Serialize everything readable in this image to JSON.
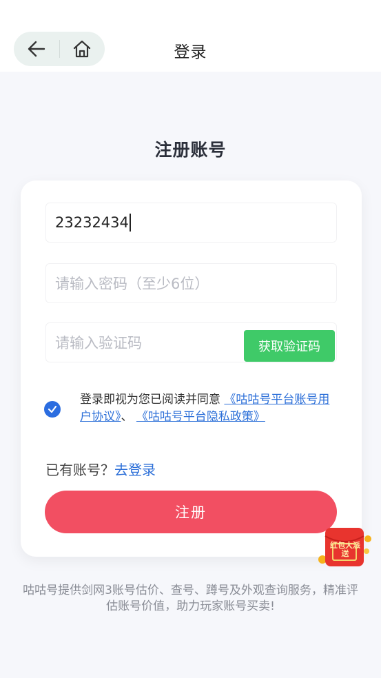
{
  "header": {
    "back_icon": "arrow-left-icon",
    "home_icon": "home-icon",
    "title": "登录"
  },
  "heading": "注册账号",
  "form": {
    "phone_value": "23232434",
    "password_placeholder": "请输入密码（至少6位）",
    "code_placeholder": "请输入验证码",
    "code_button": "获取验证码"
  },
  "agreement": {
    "checked": true,
    "text": "登录即视为您已阅读并同意",
    "link1": "《咕咕号平台账号用户协议》",
    "separator": "、",
    "link2": "《咕咕号平台隐私政策》"
  },
  "have_account": {
    "text": "已有账号？",
    "link": "去登录"
  },
  "register_button": "注册",
  "redpack": {
    "text": "红包大派送",
    "icon": "red-envelope-icon"
  },
  "footer": "咕咕号提供剑网3账号估价、查号、蹲号及外观查询服务，精准评估账号价值，助力玩家账号买卖!",
  "colors": {
    "accent_green": "#3fca68",
    "accent_red": "#f24f62",
    "link_blue": "#2c6fd8"
  }
}
